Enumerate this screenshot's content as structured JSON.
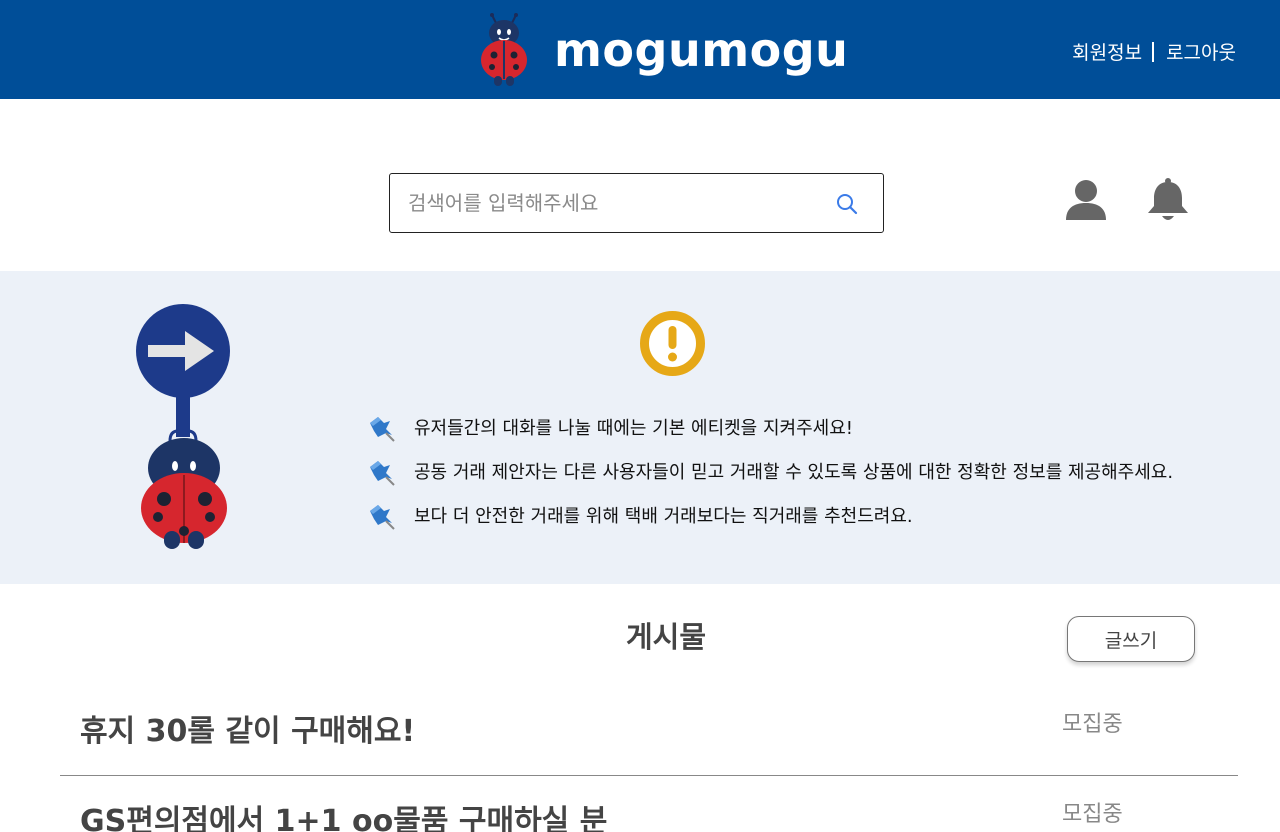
{
  "header": {
    "brand": "mogumogu",
    "profile_link": "회원정보",
    "logout_link": "로그아웃"
  },
  "search": {
    "placeholder": "검색어를 입력해주세요",
    "value": ""
  },
  "notice": {
    "rules": [
      "유저들간의 대화를 나눌 때에는 기본 에티켓을 지켜주세요!",
      "공동 거래 제안자는 다른 사용자들이 믿고 거래할 수 있도록 상품에 대한 정확한 정보를 제공해주세요.",
      "보다 더 안전한 거래를 위해 택배 거래보다는 직거래를 추천드려요."
    ]
  },
  "posts": {
    "title": "게시물",
    "write_label": "글쓰기",
    "items": [
      {
        "title": "휴지 30롤 같이 구매해요!",
        "status": "모집중"
      },
      {
        "title": "GS편의점에서 1+1  oo물품 구매하실 분",
        "status": "모집중"
      }
    ]
  },
  "colors": {
    "header_bg": "#004e98",
    "banner_bg": "#ecf1f8",
    "warning": "#e6a817",
    "text_muted": "#888888",
    "search_accent": "#3b7be8"
  },
  "icons": [
    "ladybug-logo-icon",
    "search-icon",
    "user-icon",
    "bell-icon",
    "ladybug-sign-mascot",
    "warning-icon",
    "pushpin-icon"
  ]
}
